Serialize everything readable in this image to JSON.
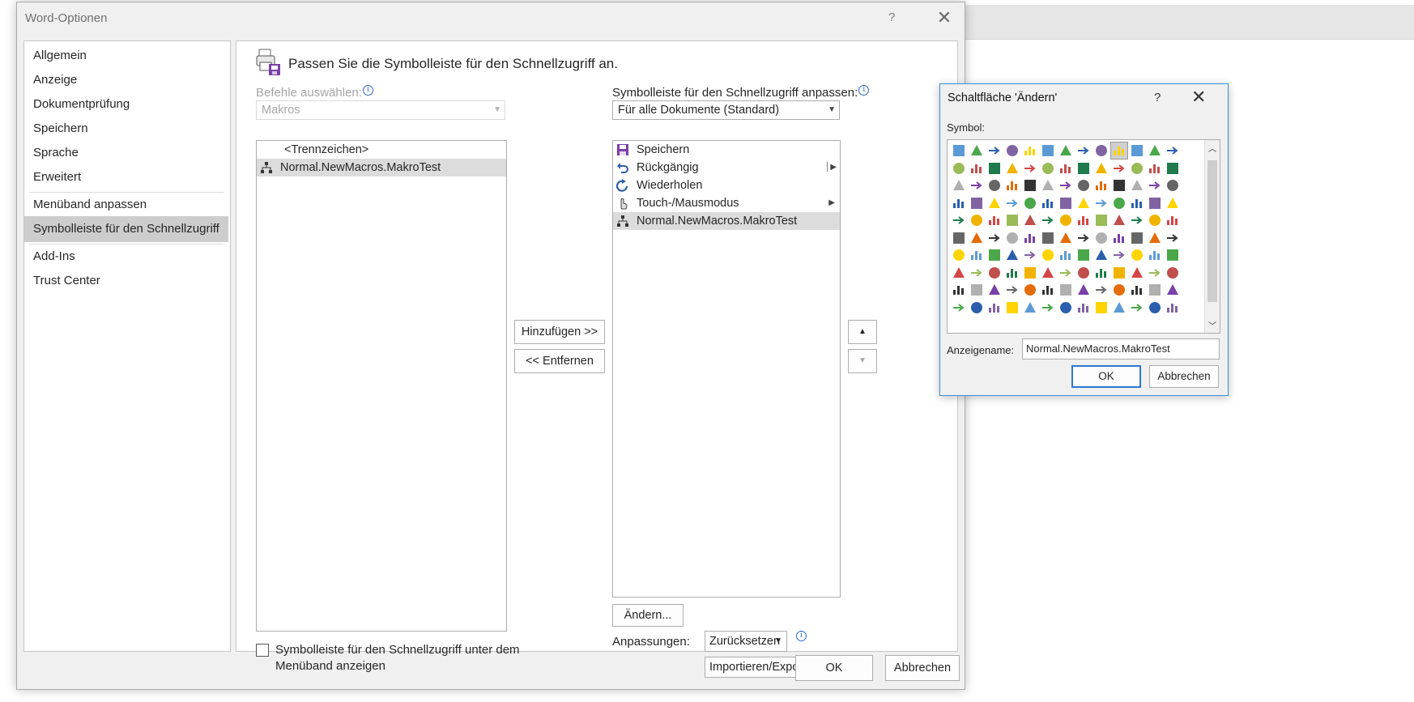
{
  "dialog": {
    "title": "Word-Optionen",
    "help": "?",
    "close": "✕",
    "nav": [
      "Allgemein",
      "Anzeige",
      "Dokumentprüfung",
      "Speichern",
      "Sprache",
      "Erweitert",
      "Menüband anpassen",
      "Symbolleiste für den Schnellzugriff",
      "Add-Ins",
      "Trust Center"
    ],
    "nav_selected": "Symbolleiste für den Schnellzugriff",
    "ok": "OK",
    "cancel": "Abbrechen"
  },
  "qat": {
    "heading": "Passen Sie die Symbolleiste für den Schnellzugriff an.",
    "choose_label": "Befehle auswählen:",
    "choose_value": "Makros",
    "customize_label": "Symbolleiste für den Schnellzugriff anpassen:",
    "customize_value": "Für alle Dokumente (Standard)",
    "left_list": [
      {
        "label": "<Trennzeichen>",
        "icon": ""
      },
      {
        "label": "Normal.NewMacros.MakroTest",
        "icon": "macro-icon"
      }
    ],
    "right_list": [
      {
        "label": "Speichern",
        "icon": "save-icon"
      },
      {
        "label": "Rückgängig",
        "icon": "undo-icon"
      },
      {
        "label": "Wiederholen",
        "icon": "redo-icon"
      },
      {
        "label": "Touch-/Mausmodus",
        "icon": "touch-icon"
      },
      {
        "label": "Normal.NewMacros.MakroTest",
        "icon": "macro-icon"
      }
    ],
    "add": "Hinzufügen >>",
    "remove": "<< Entfernen",
    "modify": "Ändern...",
    "show_below_line1": "Symbolleiste für den Schnellzugriff unter dem",
    "show_below_line2": "Menüband anzeigen",
    "customizations_label": "Anpassungen:",
    "reset": "Zurücksetzen",
    "import_export": "Importieren/Exportieren"
  },
  "modify_dialog": {
    "title": "Schaltfläche 'Ändern'",
    "help": "?",
    "close": "✕",
    "symbol_label": "Symbol:",
    "display_name_label": "Anzeigename:",
    "display_name_value": "Normal.NewMacros.MakroTest",
    "ok": "OK",
    "cancel": "Abbrechen"
  }
}
